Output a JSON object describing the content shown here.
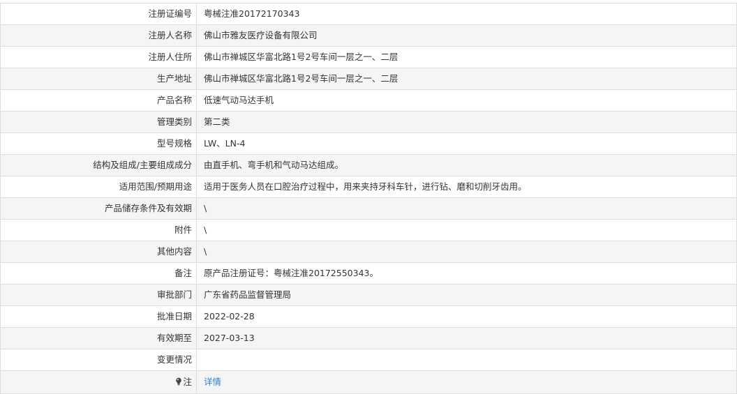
{
  "rows": [
    {
      "label": "注册证编号",
      "value": "粤械注准20172170343"
    },
    {
      "label": "注册人名称",
      "value": "佛山市雅友医疗设备有限公司"
    },
    {
      "label": "注册人住所",
      "value": "佛山市禅城区华富北路1号2号车间一层之一、二层"
    },
    {
      "label": "生产地址",
      "value": "佛山市禅城区华富北路1号2号车间一层之一、二层"
    },
    {
      "label": "产品名称",
      "value": "低速气动马达手机"
    },
    {
      "label": "管理类别",
      "value": "第二类"
    },
    {
      "label": "型号规格",
      "value": "LW、LN-4"
    },
    {
      "label": "结构及组成/主要组成成分",
      "value": "由直手机、弯手机和气动马达组成。"
    },
    {
      "label": "适用范围/预期用途",
      "value": "适用于医务人员在口腔治疗过程中，用来夹持牙科车针，进行钻、磨和切削牙齿用。"
    },
    {
      "label": "产品储存条件及有效期",
      "value": "\\"
    },
    {
      "label": "附件",
      "value": "\\"
    },
    {
      "label": "其他内容",
      "value": "\\"
    },
    {
      "label": "备注",
      "value": "原产品注册证号：粤械注准20172550343。"
    },
    {
      "label": "审批部门",
      "value": "广东省药品监督管理局"
    },
    {
      "label": "批准日期",
      "value": "2022-02-28"
    },
    {
      "label": "有效期至",
      "value": "2027-03-13"
    },
    {
      "label": "变更情况",
      "value": ""
    }
  ],
  "note": {
    "icon": "lightbulb-icon",
    "label": "注",
    "link_text": "详情",
    "link_color": "#2f7fd0"
  }
}
